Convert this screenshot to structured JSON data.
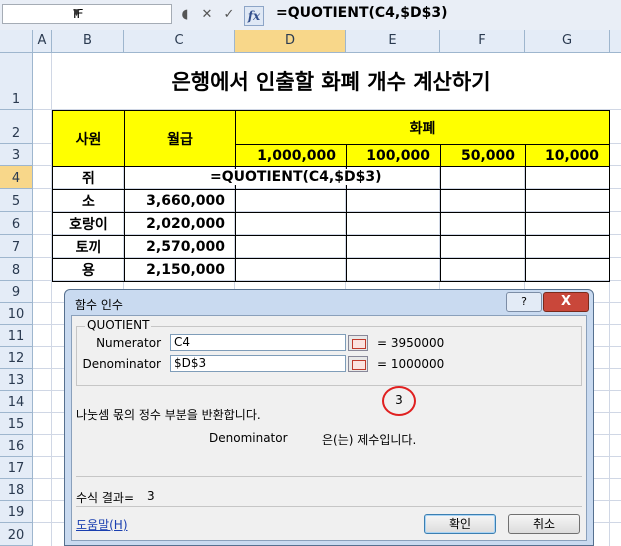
{
  "formula_bar": {
    "name_box": "IF",
    "name_box_dropdown": "▼",
    "cancel_glyph": "✕",
    "enter_glyph": "✓",
    "fx_label": "fx",
    "formula": "=QUOTIENT(C4,$D$3)"
  },
  "columns": [
    "A",
    "B",
    "C",
    "D",
    "E",
    "F",
    "G"
  ],
  "rows": [
    "1",
    "2",
    "3",
    "4",
    "5",
    "6",
    "7",
    "8",
    "9",
    "10",
    "11",
    "12",
    "13",
    "14",
    "15",
    "16",
    "17",
    "18",
    "19",
    "20"
  ],
  "sheet": {
    "title": "은행에서 인출할 화폐 개수 계산하기",
    "header_employee": "사원",
    "header_salary": "월급",
    "header_currency": "화폐",
    "denominations": [
      "1,000,000",
      "100,000",
      "50,000",
      "10,000"
    ],
    "employees": [
      {
        "name": "쥐",
        "salary": ""
      },
      {
        "name": "소",
        "salary": "3,660,000"
      },
      {
        "name": "호랑이",
        "salary": "2,020,000"
      },
      {
        "name": "토끼",
        "salary": "2,570,000"
      },
      {
        "name": "용",
        "salary": "2,150,000"
      }
    ],
    "editing_formula": "=QUOTIENT(C4,$D$3)"
  },
  "dialog": {
    "title": "함수 인수",
    "help_glyph": "?",
    "close_glyph": "X",
    "function_name": "QUOTIENT",
    "args": [
      {
        "label": "Numerator",
        "value": "C4",
        "result": "= 3950000"
      },
      {
        "label": "Denominator",
        "value": "$D$3",
        "result": "= 1000000"
      }
    ],
    "circled_result": "3",
    "description": "나눗셈 몫의 정수 부분을 반환합니다.",
    "arg_help_name": "Denominator",
    "arg_help_text": "은(는) 제수입니다.",
    "result_label": "수식 결과=",
    "result_value": "3",
    "help_link": "도움말(H)",
    "ok_label": "확인",
    "cancel_label": "취소"
  }
}
